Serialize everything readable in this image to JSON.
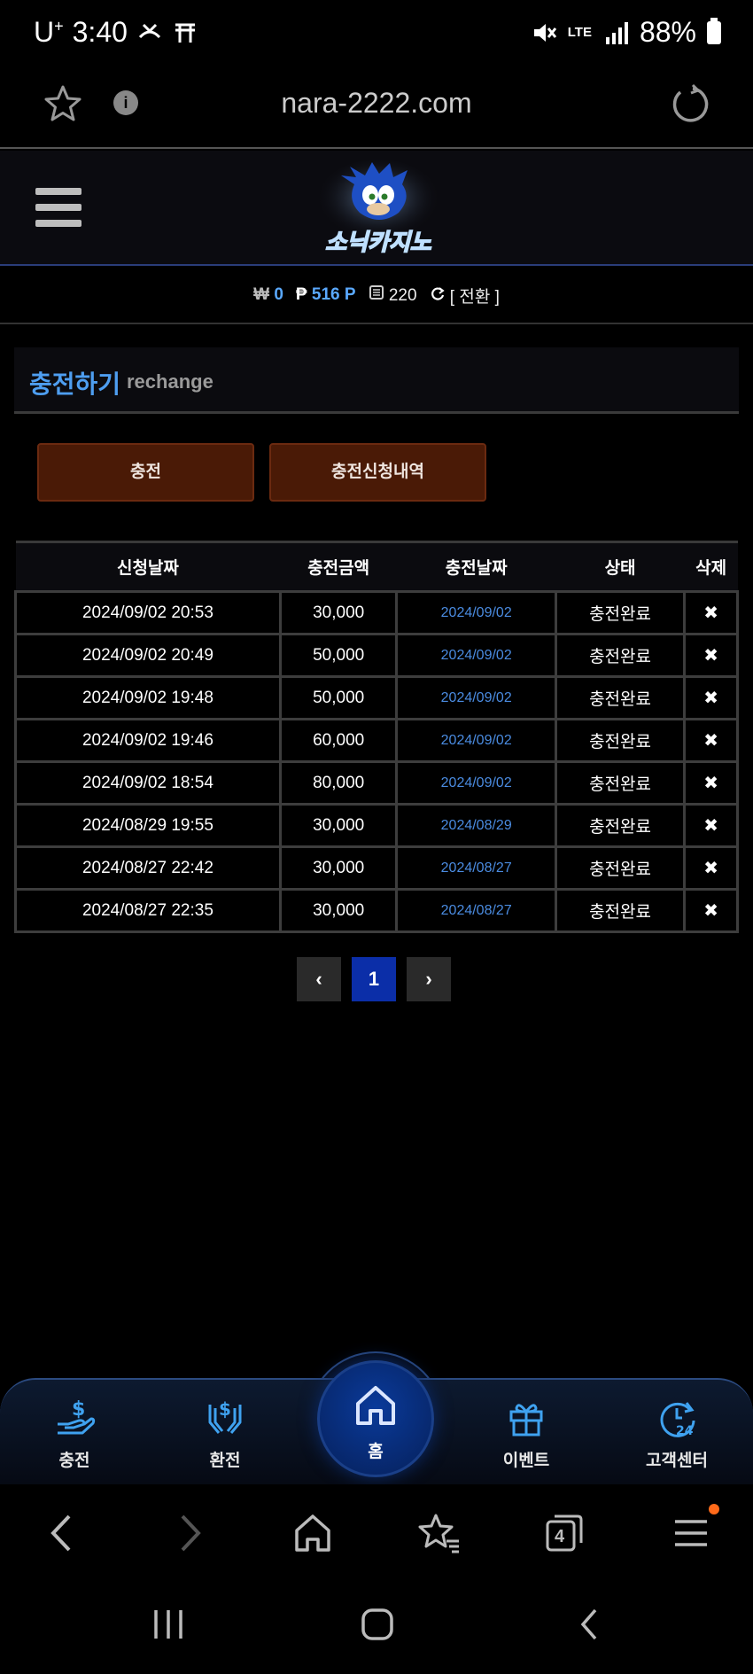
{
  "status_bar": {
    "carrier": "U",
    "carrier_sup": "+",
    "time": "3:40",
    "battery": "88%",
    "network": "LTE"
  },
  "browser": {
    "url": "nara-2222.com"
  },
  "site": {
    "logo_text": "소닉카지노"
  },
  "balance": {
    "won_symbol": "₩",
    "won_value": "0",
    "point_symbol": "₱",
    "point_value": "516 P",
    "chip_value": "220",
    "convert_label": "[ 전환 ]"
  },
  "section": {
    "title_ko": "충전하기",
    "title_en": "rechange"
  },
  "buttons": {
    "charge": "충전",
    "history": "충전신청내역"
  },
  "table": {
    "headers": [
      "신청날짜",
      "충전금액",
      "충전날짜",
      "상태",
      "삭제"
    ],
    "rows": [
      {
        "requested": "2024/09/02 20:53",
        "amount": "30,000",
        "charged": "2024/09/02",
        "status": "충전완료",
        "delete": "✖"
      },
      {
        "requested": "2024/09/02 20:49",
        "amount": "50,000",
        "charged": "2024/09/02",
        "status": "충전완료",
        "delete": "✖"
      },
      {
        "requested": "2024/09/02 19:48",
        "amount": "50,000",
        "charged": "2024/09/02",
        "status": "충전완료",
        "delete": "✖"
      },
      {
        "requested": "2024/09/02 19:46",
        "amount": "60,000",
        "charged": "2024/09/02",
        "status": "충전완료",
        "delete": "✖"
      },
      {
        "requested": "2024/09/02 18:54",
        "amount": "80,000",
        "charged": "2024/09/02",
        "status": "충전완료",
        "delete": "✖"
      },
      {
        "requested": "2024/08/29 19:55",
        "amount": "30,000",
        "charged": "2024/08/29",
        "status": "충전완료",
        "delete": "✖"
      },
      {
        "requested": "2024/08/27 22:42",
        "amount": "30,000",
        "charged": "2024/08/27",
        "status": "충전완료",
        "delete": "✖"
      },
      {
        "requested": "2024/08/27 22:35",
        "amount": "30,000",
        "charged": "2024/08/27",
        "status": "충전완료",
        "delete": "✖"
      }
    ]
  },
  "pagination": {
    "prev": "‹",
    "current": "1",
    "next": "›"
  },
  "bottom_nav": {
    "charge": "충전",
    "exchange": "환전",
    "home": "홈",
    "event": "이벤트",
    "support": "고객센터"
  },
  "browser_toolbar": {
    "tabs_count": "4"
  },
  "colors": {
    "accent_blue": "#4e9ef0",
    "button_brown": "#4a1a06",
    "active_page": "#0b2ea8",
    "notification_dot": "#ff6a1a"
  }
}
